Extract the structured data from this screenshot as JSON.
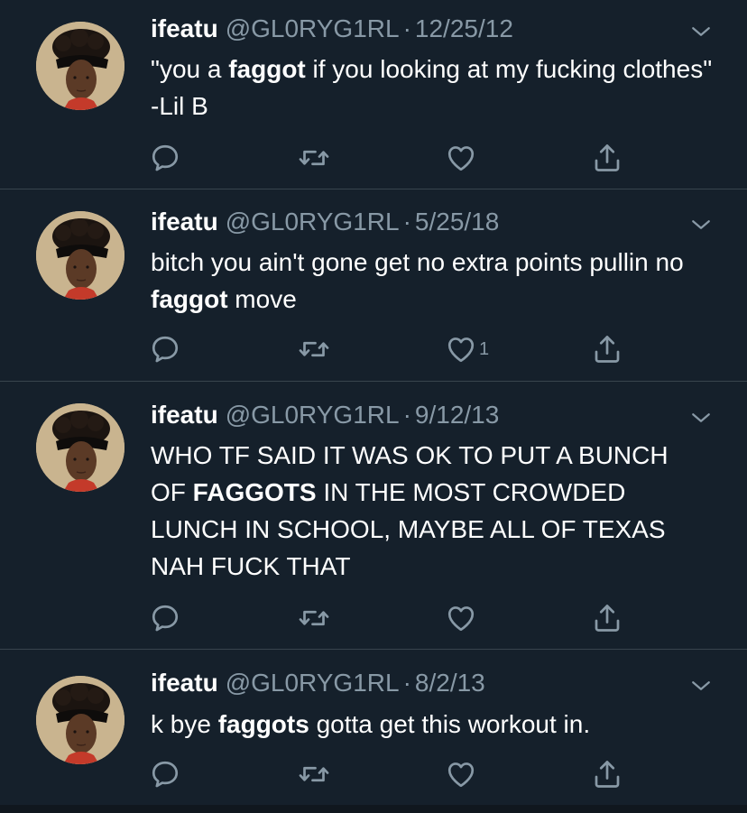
{
  "theme": {
    "background": "#15202b",
    "divider": "#38444d",
    "muted_text": "#8899a6",
    "primary_text": "#ffffff"
  },
  "tweets": [
    {
      "name": "ifeatu",
      "handle": "@GL0RYG1RL",
      "separator": "·",
      "date": "12/25/12",
      "text_parts": [
        "\"you a ",
        "faggot",
        " if you looking at my fucking clothes\" -Lil B"
      ],
      "like_count": "",
      "icons": [
        "reply-icon",
        "retweet-icon",
        "like-icon",
        "share-icon",
        "chevron-down-icon"
      ]
    },
    {
      "name": "ifeatu",
      "handle": "@GL0RYG1RL",
      "separator": "·",
      "date": "5/25/18",
      "text_parts": [
        "bitch you ain't gone get no extra points pullin no ",
        "faggot",
        " move"
      ],
      "like_count": "1",
      "icons": [
        "reply-icon",
        "retweet-icon",
        "like-icon",
        "share-icon",
        "chevron-down-icon"
      ]
    },
    {
      "name": "ifeatu",
      "handle": "@GL0RYG1RL",
      "separator": "·",
      "date": "9/12/13",
      "text_parts": [
        "WHO TF SAID IT WAS OK TO PUT A BUNCH OF ",
        "FAGGOTS",
        " IN THE MOST CROWDED LUNCH IN SCHOOL, MAYBE ALL OF TEXAS NAH FUCK THAT"
      ],
      "like_count": "",
      "icons": [
        "reply-icon",
        "retweet-icon",
        "like-icon",
        "share-icon",
        "chevron-down-icon"
      ]
    },
    {
      "name": "ifeatu",
      "handle": "@GL0RYG1RL",
      "separator": "·",
      "date": "8/2/13",
      "text_parts": [
        "k bye ",
        "faggots",
        " gotta get this workout in."
      ],
      "like_count": "",
      "icons": [
        "reply-icon",
        "retweet-icon",
        "like-icon",
        "share-icon",
        "chevron-down-icon"
      ]
    }
  ]
}
